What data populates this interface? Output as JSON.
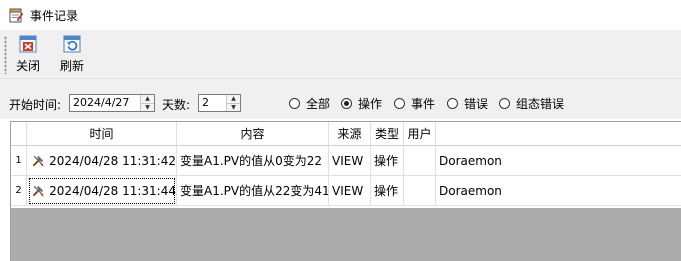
{
  "window": {
    "title": "事件记录",
    "icon": "notepad-icon"
  },
  "toolbar": {
    "close": {
      "label": "关闭",
      "icon": "close-icon"
    },
    "refresh": {
      "label": "刷新",
      "icon": "refresh-icon"
    }
  },
  "filter": {
    "start_time_label": "开始时间:",
    "start_time_value": "2024/4/27",
    "days_label": "天数:",
    "days_value": "2",
    "options": [
      {
        "label": "全部",
        "selected": false
      },
      {
        "label": "操作",
        "selected": true
      },
      {
        "label": "事件",
        "selected": false
      },
      {
        "label": "错误",
        "selected": false
      },
      {
        "label": "组态错误",
        "selected": false
      }
    ]
  },
  "grid": {
    "columns": [
      "时间",
      "内容",
      "来源",
      "类型",
      "用户",
      ""
    ],
    "rows": [
      {
        "num": "1",
        "time": "2024/04/28 11:31:42",
        "content": "变量A1.PV的值从0变为22",
        "source": "VIEW",
        "type": "操作",
        "user": "",
        "extra": "Doraemon"
      },
      {
        "num": "2",
        "time": "2024/04/28 11:31:44",
        "content": "变量A1.PV的值从22变为41",
        "source": "VIEW",
        "type": "操作",
        "user": "",
        "extra": "Doraemon"
      }
    ]
  },
  "colors": {
    "toolbar_bg": "#f0f0f0",
    "empty_area": "#ababab",
    "close_red": "#d9342b",
    "refresh_blue": "#2a6fc9"
  }
}
